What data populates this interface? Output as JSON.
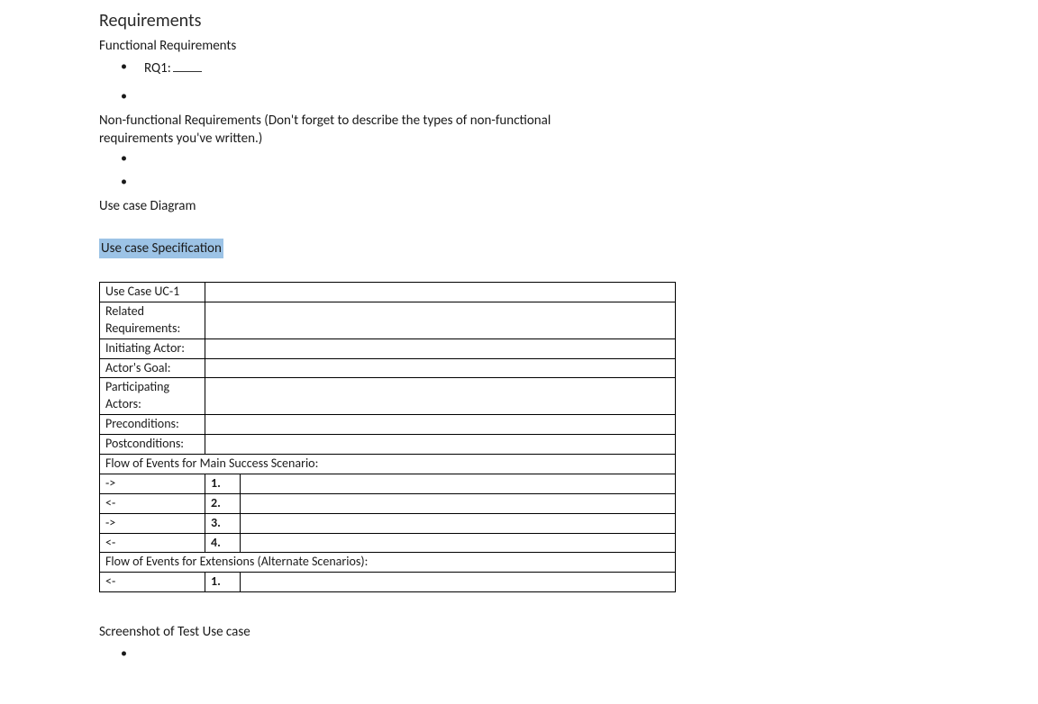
{
  "sections": {
    "requirements_title": "Requirements",
    "functional_heading": "Functional Requirements",
    "rq1_label": "RQ1:",
    "nonfunctional_heading": "Non-functional Requirements (Don't forget to describe the types of non-functional requirements you've written.)",
    "usecase_diagram_heading": "Use case Diagram",
    "usecase_spec_heading": "Use case Specification",
    "screenshot_heading": "Screenshot of Test Use case"
  },
  "uc_table": {
    "rows_meta": [
      {
        "label": "Use Case UC-1",
        "value": ""
      },
      {
        "label": "Related Requirements:",
        "value": ""
      },
      {
        "label": "Initiating Actor:",
        "value": ""
      },
      {
        "label": "Actor's Goal:",
        "value": ""
      },
      {
        "label": "Participating Actors:",
        "value": ""
      },
      {
        "label": "Preconditions:",
        "value": ""
      },
      {
        "label": "Postconditions:",
        "value": ""
      }
    ],
    "flow_main_header": "Flow of Events for Main Success Scenario:",
    "flow_main": [
      {
        "dir": "->",
        "num": "1.",
        "desc": ""
      },
      {
        "dir": "<-",
        "num": "2.",
        "desc": ""
      },
      {
        "dir": "->",
        "num": "3.",
        "desc": ""
      },
      {
        "dir": "<-",
        "num": "4.",
        "desc": ""
      }
    ],
    "flow_ext_header": "Flow of Events for Extensions (Alternate Scenarios):",
    "flow_ext": [
      {
        "dir": "<-",
        "num": "1.",
        "desc": ""
      }
    ]
  }
}
